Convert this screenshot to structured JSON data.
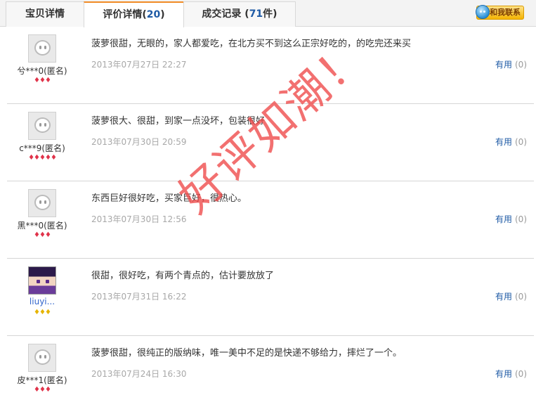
{
  "tabs": [
    {
      "label": "宝贝详情"
    },
    {
      "label": "评价详情(",
      "count": "20",
      "suffix": ")"
    },
    {
      "label": "成交记录 (",
      "count": "71",
      "suffix": "件)"
    }
  ],
  "contact_label": "和我联系",
  "useful_label": "有用",
  "watermark": "好评如潮！",
  "reviews": [
    {
      "user": "兮***0(匿名)",
      "rank": "♦♦♦",
      "comment": "菠萝很甜，无眼的，家人都爱吃，在北方买不到这么正宗好吃的，的吃完还来买",
      "date": "2013年07月27日 22:27",
      "useful_count": "(0)"
    },
    {
      "user": "c***9(匿名)",
      "rank": "♦♦♦♦♦",
      "comment": "菠萝很大、很甜，到家一点没坏，包装很好",
      "date": "2013年07月30日 20:59",
      "useful_count": "(0)"
    },
    {
      "user": "黑***0(匿名)",
      "rank": "♦♦♦",
      "comment": "东西巨好很好吃，买家巨好，很热心。",
      "date": "2013年07月30日 12:56",
      "useful_count": "(0)"
    },
    {
      "user": "liuyi...",
      "rank": "♦♦♦",
      "comment": "很甜，很好吃，有两个青点的，估计要放放了",
      "date": "2013年07月31日 16:22",
      "useful_count": "(0)"
    },
    {
      "user": "皮***1(匿名)",
      "rank": "♦♦♦",
      "comment": "菠萝很甜，很纯正的版纳味，唯一美中不足的是快递不够给力，摔烂了一个。",
      "date": "2013年07月24日 16:30",
      "useful_count": "(0)"
    }
  ]
}
